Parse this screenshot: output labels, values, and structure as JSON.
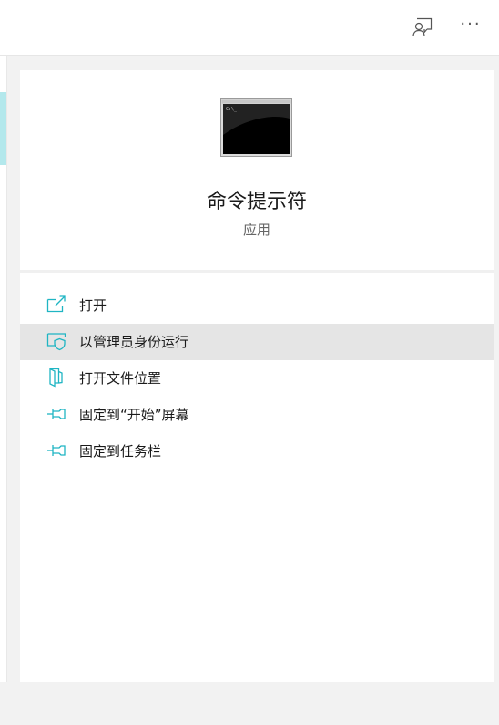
{
  "topbar": {
    "feedback_icon": "feedback-person-icon",
    "more_label": "···"
  },
  "app": {
    "title": "命令提示符",
    "subtitle": "应用",
    "icon": "command-prompt-icon"
  },
  "menu": {
    "items": [
      {
        "label": "打开",
        "icon": "open-external-icon",
        "hovered": false
      },
      {
        "label": "以管理员身份运行",
        "icon": "shield-admin-icon",
        "hovered": true
      },
      {
        "label": "打开文件位置",
        "icon": "folder-location-icon",
        "hovered": false
      },
      {
        "label": "固定到“开始”屏幕",
        "icon": "pin-start-icon",
        "hovered": false
      },
      {
        "label": "固定到任务栏",
        "icon": "pin-taskbar-icon",
        "hovered": false
      }
    ]
  },
  "colors": {
    "accent": "#1fb5c3",
    "hover_bg": "#e5e5e5",
    "selection_strip": "#b3e8ec"
  }
}
